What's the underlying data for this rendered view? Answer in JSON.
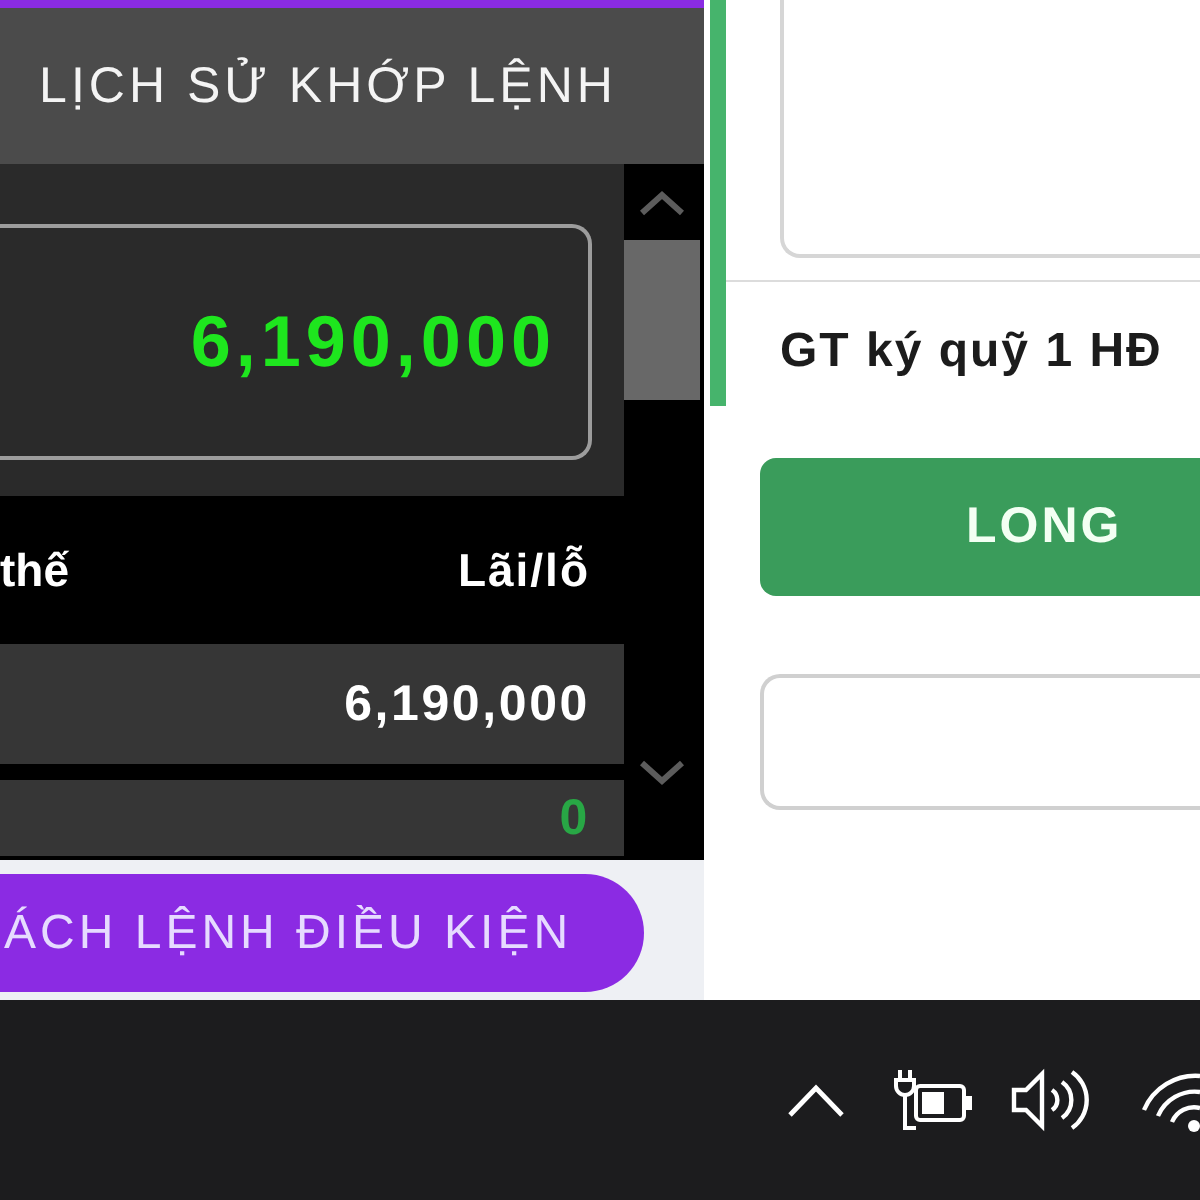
{
  "history_panel": {
    "title": "LỊCH SỬ KHỚP LỆNH",
    "summary": {
      "value": "6,190,000"
    },
    "table": {
      "columns": [
        "thế",
        "Lãi/lỗ"
      ],
      "rows": [
        {
          "profit_loss": "6,190,000",
          "color": "#ffffff"
        },
        {
          "profit_loss": "0",
          "color": "#28a745"
        }
      ]
    },
    "conditional_orders_button": {
      "label": "ÁCH LỆNH ĐIỀU KIỆN"
    }
  },
  "order_form": {
    "margin_label": "GT ký quỹ 1 HĐ",
    "long_button": {
      "label": "LONG"
    }
  }
}
